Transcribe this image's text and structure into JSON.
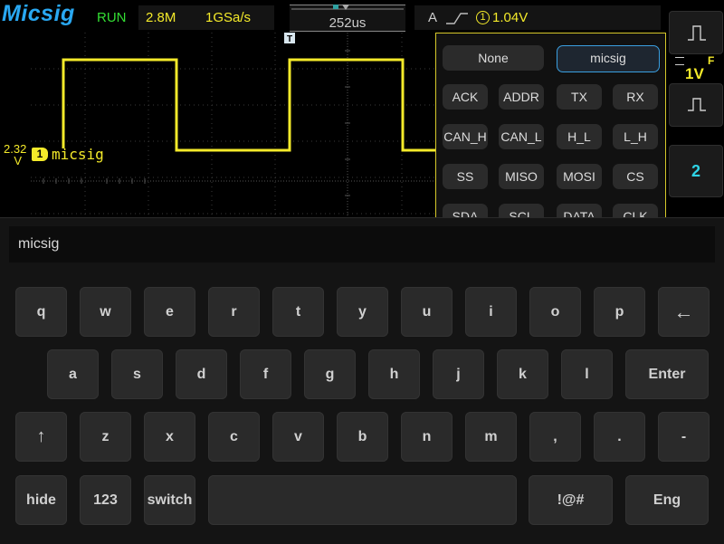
{
  "top": {
    "logo": "Micsig",
    "status": "RUN",
    "memory_depth": "2.8M",
    "sample_rate": "1GSa/s",
    "timebase": "252us",
    "trigger_source": "A",
    "trigger_level_channel": "1",
    "trigger_level": "1.04V"
  },
  "channel": {
    "number": "1",
    "label": "micsig",
    "offset_value": "2.32",
    "offset_unit": "V",
    "color": "#f4ea2a"
  },
  "trigger_marker": "T",
  "right_panel": {
    "scale": "1V",
    "flag": "F",
    "channel2": "2"
  },
  "labels_popup": {
    "none_label": "None",
    "custom_label": "micsig",
    "presets": [
      "ACK",
      "ADDR",
      "TX",
      "RX",
      "CAN_H",
      "CAN_L",
      "H_L",
      "L_H",
      "SS",
      "MISO",
      "MOSI",
      "CS",
      "SDA",
      "SCL",
      "DATA",
      "CLK"
    ]
  },
  "keyboard": {
    "input_value": "micsig",
    "row1": [
      "q",
      "w",
      "e",
      "r",
      "t",
      "y",
      "u",
      "i",
      "o",
      "p",
      "←"
    ],
    "row2": [
      "a",
      "s",
      "d",
      "f",
      "g",
      "h",
      "j",
      "k",
      "l",
      "Enter"
    ],
    "row3": [
      "↑",
      "z",
      "x",
      "c",
      "v",
      "b",
      "n",
      "m",
      ",",
      ".",
      "-"
    ],
    "row4": [
      "hide",
      "123",
      "switch",
      "",
      "!@#",
      "Eng"
    ]
  },
  "colors": {
    "channel1": "#f4ea2a",
    "brand": "#29a8f2",
    "run": "#33dd33",
    "channel2": "#2fd4e6",
    "popup_border": "#d6c82a",
    "selected": "#3a9fe0"
  }
}
